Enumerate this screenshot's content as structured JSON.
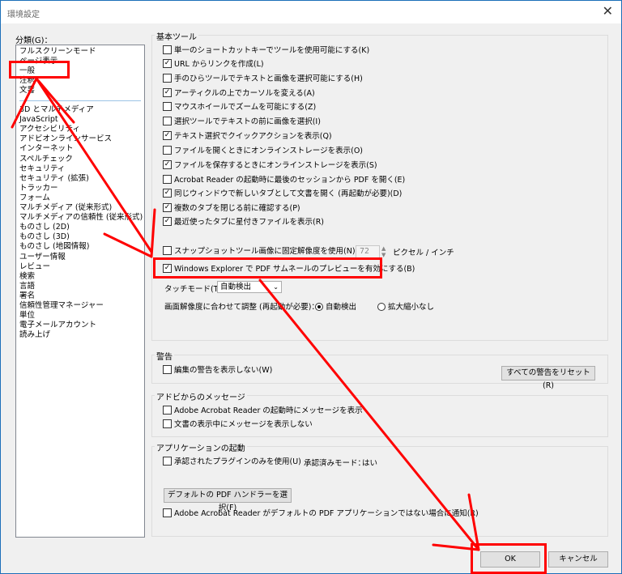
{
  "window": {
    "title": "環境設定"
  },
  "categories": {
    "label": "分類(G)：",
    "items_top": [
      "フルスクリーンモード",
      "ページ表示",
      "一般",
      "注釈",
      "文書"
    ],
    "items": [
      "3D とマルチメディア",
      "JavaScript",
      "アクセシビリティ",
      "アドビオンラインサービス",
      "インターネット",
      "スペルチェック",
      "セキュリティ",
      "セキュリティ (拡張)",
      "トラッカー",
      "フォーム",
      "マルチメディア (従来形式)",
      "マルチメディアの信頼性 (従来形式)",
      "ものさし (2D)",
      "ものさし (3D)",
      "ものさし (地図情報)",
      "ユーザー情報",
      "レビュー",
      "検索",
      "言語",
      "署名",
      "信頼性管理マネージャー",
      "単位",
      "電子メールアカウント",
      "読み上げ"
    ]
  },
  "basic_tools": {
    "label": "基本ツール",
    "options": [
      {
        "text": "単一のショートカットキーでツールを使用可能にする(K)",
        "checked": false
      },
      {
        "text": "URL からリンクを作成(L)",
        "checked": true
      },
      {
        "text": "手のひらツールでテキストと画像を選択可能にする(H)",
        "checked": false
      },
      {
        "text": "アーティクルの上でカーソルを変える(A)",
        "checked": true
      },
      {
        "text": "マウスホイールでズームを可能にする(Z)",
        "checked": false
      },
      {
        "text": "選択ツールでテキストの前に画像を選択(I)",
        "checked": false
      },
      {
        "text": "テキスト選択でクイックアクションを表示(Q)",
        "checked": true
      },
      {
        "text": "ファイルを開くときにオンラインストレージを表示(O)",
        "checked": false
      },
      {
        "text": "ファイルを保存するときにオンラインストレージを表示(S)",
        "checked": true
      },
      {
        "text": "Acrobat Reader の起動時に最後のセッションから PDF を開く(E)",
        "checked": false
      },
      {
        "text": "同じウィンドウで新しいタブとして文書を開く (再起動が必要)(D)",
        "checked": true
      },
      {
        "text": "複数のタブを閉じる前に確認する(P)",
        "checked": true
      },
      {
        "text": "最近使ったタブに星付きファイルを表示(R)",
        "checked": true
      }
    ],
    "snapshot": {
      "text": "スナップショットツール画像に固定解像度を使用(N)：",
      "checked": false,
      "value": "72",
      "unit": "ピクセル / インチ"
    },
    "windows_explorer": {
      "text": "Windows Explorer で PDF サムネールのプレビューを有効にする(B)",
      "checked": true
    },
    "touch_mode": {
      "label": "タッチモード(T)：",
      "value": "自動検出"
    },
    "resolution": {
      "label": "画面解像度に合わせて調整 (再起動が必要)：",
      "opt1": "自動検出",
      "opt2": "拡大縮小なし",
      "opt1_on": true
    }
  },
  "warnings": {
    "label": "警告",
    "option": "編集の警告を表示しない(W)",
    "reset_button": "すべての警告をリセット(R)"
  },
  "messages": {
    "label": "アドビからのメッセージ",
    "options": [
      "Adobe Acrobat Reader の起動時にメッセージを表示",
      "文書の表示中にメッセージを表示しない"
    ]
  },
  "startup": {
    "label": "アプリケーションの起動",
    "option": "承認されたプラグインのみを使用(U)",
    "approved_mode": "承認済みモード：",
    "approved_value": "はい",
    "default_handler_button": "デフォルトの PDF ハンドラーを選択(F)",
    "notify": "Adobe Acrobat Reader がデフォルトの PDF アプリケーションではない場合に通知(R)"
  },
  "footer": {
    "ok": "OK",
    "cancel": "キャンセル"
  },
  "colors": {
    "annotation": "#ff0000",
    "title_border": "#1c6fb9"
  }
}
